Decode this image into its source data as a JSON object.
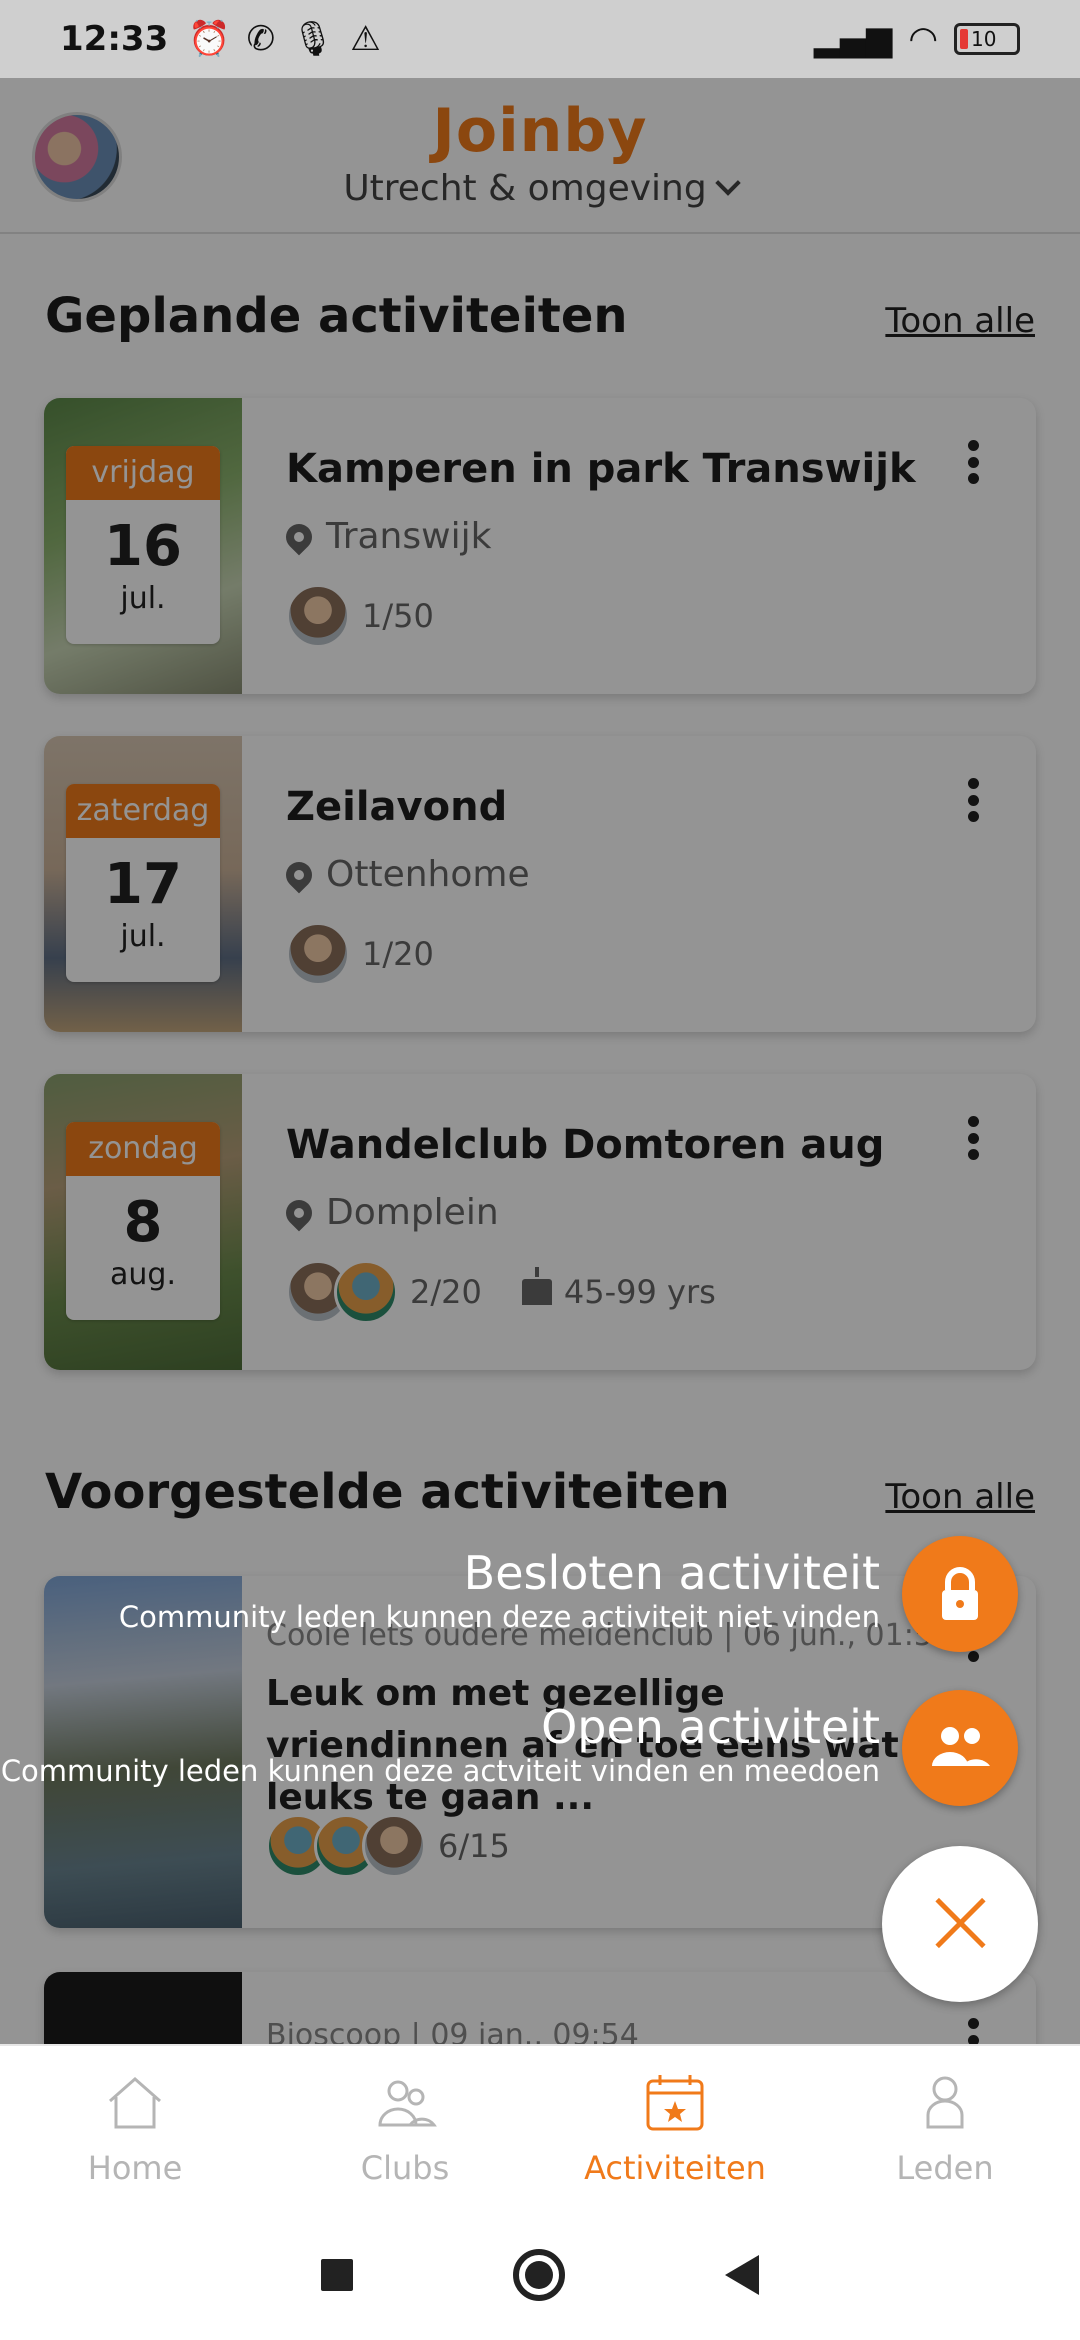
{
  "status_bar": {
    "time": "12:33",
    "battery": "10"
  },
  "header": {
    "brand": "Joinby",
    "region": "Utrecht & omgeving"
  },
  "planned": {
    "title": "Geplande activiteiten",
    "see_all": "Toon alle",
    "cards": [
      {
        "day": "vrijdag",
        "date": "16",
        "month": "jul.",
        "title": "Kamperen in park Transwijk",
        "location": "Transwijk",
        "attendance": "1/50"
      },
      {
        "day": "zaterdag",
        "date": "17",
        "month": "jul.",
        "title": "Zeilavond",
        "location": "Ottenhome",
        "attendance": "1/20"
      },
      {
        "day": "zondag",
        "date": "8",
        "month": "aug.",
        "title": "Wandelclub Domtoren aug",
        "location": "Domplein",
        "attendance": "2/20",
        "age": "45-99 yrs"
      }
    ]
  },
  "suggested": {
    "title": "Voorgestelde activiteiten",
    "see_all": "Toon alle",
    "cards": [
      {
        "subline": "Coole lets oudere meidenclub | 06 jun., 01:55",
        "title": "Leuk om met gezellige vriendinnen af en toe eens wat leuks te gaan ...",
        "attendance": "6/15"
      },
      {
        "subline": "Bioscoop | 09 jan., 09:54"
      }
    ]
  },
  "fab_menu": {
    "closed": {
      "label": "Besloten activiteit",
      "description": "Community leden kunnen deze activiteit niet vinden"
    },
    "open": {
      "label": "Open activiteit",
      "description": "Community leden kunnen deze actviteit vinden en meedoen"
    }
  },
  "bottom_nav": [
    {
      "label": "Home",
      "icon": "home-icon"
    },
    {
      "label": "Clubs",
      "icon": "clubs-icon"
    },
    {
      "label": "Activiteiten",
      "icon": "calendar-icon",
      "active": true
    },
    {
      "label": "Leden",
      "icon": "person-icon"
    }
  ],
  "colors": {
    "accent": "#f07a1a"
  }
}
